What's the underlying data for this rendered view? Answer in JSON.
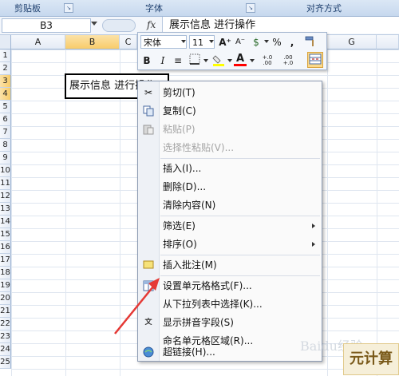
{
  "ribbon": {
    "groups": [
      "剪贴板",
      "字体",
      "对齐方式"
    ]
  },
  "formula_bar": {
    "name_box": "B3",
    "fx_label": "fx",
    "content": "展示信息 进行操作"
  },
  "columns": [
    "A",
    "B",
    "C",
    "G"
  ],
  "selected_column": "B",
  "rows": [
    "1",
    "2",
    "3",
    "4",
    "5",
    "6",
    "7",
    "8",
    "9",
    "10",
    "11",
    "12",
    "13",
    "14",
    "15",
    "16",
    "17",
    "18",
    "19",
    "20",
    "21",
    "22",
    "23",
    "24",
    "25"
  ],
  "active_cell": {
    "ref": "B3",
    "text": "展示信息 进行操作"
  },
  "mini_toolbar": {
    "font_name": "宋体",
    "font_size": "11",
    "grow_font": "A⁺",
    "shrink_font": "A⁻",
    "currency": "$",
    "percent": "%",
    "comma": ",",
    "format_painter": "format-painter-icon",
    "bold": "B",
    "italic": "I",
    "align": "≡",
    "borders": "borders-icon",
    "fill_color": "fill-color-icon",
    "font_color": "A",
    "increase_decimal": "+.0 .00",
    "decrease_decimal": ".00 +.0",
    "merge": "merge-icon",
    "fill_color_hex": "#ffff00",
    "font_color_hex": "#ff0000"
  },
  "context_menu": {
    "items": [
      {
        "label": "剪切(T)",
        "icon": "scissors-icon",
        "disabled": false
      },
      {
        "label": "复制(C)",
        "icon": "copy-icon",
        "disabled": false
      },
      {
        "label": "粘贴(P)",
        "icon": "paste-icon",
        "disabled": true
      },
      {
        "label": "选择性粘贴(V)...",
        "icon": "",
        "disabled": true
      },
      {
        "label": "插入(I)...",
        "icon": "",
        "disabled": false
      },
      {
        "label": "删除(D)...",
        "icon": "",
        "disabled": false
      },
      {
        "label": "清除内容(N)",
        "icon": "",
        "disabled": false
      },
      {
        "label": "筛选(E)",
        "icon": "",
        "disabled": false,
        "submenu": true
      },
      {
        "label": "排序(O)",
        "icon": "",
        "disabled": false,
        "submenu": true
      },
      {
        "label": "插入批注(M)",
        "icon": "comment-icon",
        "disabled": false
      },
      {
        "label": "设置单元格格式(F)...",
        "icon": "format-cells-icon",
        "disabled": false
      },
      {
        "label": "从下拉列表中选择(K)...",
        "icon": "",
        "disabled": false
      },
      {
        "label": "显示拼音字段(S)",
        "icon": "phonetic-icon",
        "disabled": false
      },
      {
        "label": "命名单元格区域(R)...",
        "icon": "",
        "disabled": false
      },
      {
        "label": "超链接(H)...",
        "icon": "hyperlink-icon",
        "disabled": false
      }
    ]
  },
  "annotation_arrow_color": "#e53935",
  "watermark": {
    "text": "Baidu经验",
    "badge": "元计算"
  }
}
